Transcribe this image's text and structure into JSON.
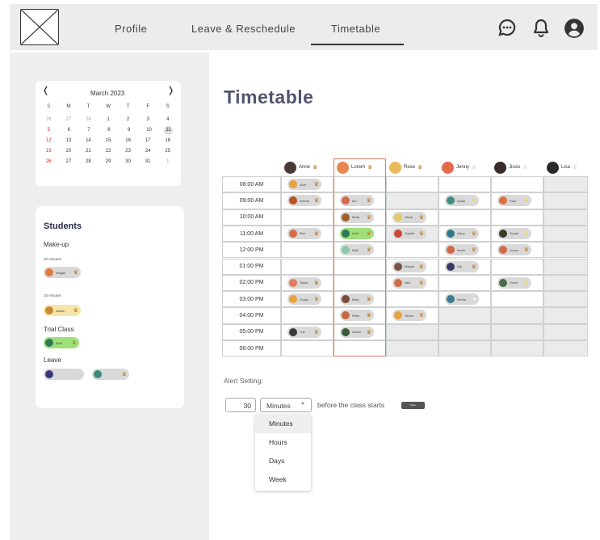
{
  "nav": {
    "profile": "Profile",
    "leave": "Leave & Reschedule",
    "timetable": "Timetable"
  },
  "calendar": {
    "title": "March 2023",
    "prev": "❬",
    "next": "❭",
    "weekdays": [
      "S",
      "M",
      "T",
      "W",
      "T",
      "F",
      "S"
    ],
    "weeks": [
      [
        "26",
        "27",
        "28",
        "1",
        "2",
        "3",
        "4"
      ],
      [
        "5",
        "6",
        "7",
        "8",
        "9",
        "10",
        "11"
      ],
      [
        "12",
        "13",
        "14",
        "15",
        "16",
        "17",
        "18"
      ],
      [
        "19",
        "20",
        "21",
        "22",
        "23",
        "24",
        "25"
      ],
      [
        "26",
        "27",
        "28",
        "29",
        "30",
        "31",
        "1"
      ]
    ],
    "selected": "11"
  },
  "students": {
    "title": "Students",
    "makeup": "Make-up",
    "m45": "45 minutes",
    "abigail": "Abigail",
    "m15": "15 minutes",
    "adrian": "Adrian",
    "trial": "Trial Class",
    "ariel": "Ariel",
    "leave": "Leave"
  },
  "page_title": "Timetable",
  "teachers": [
    {
      "name": "Anne",
      "c": "#4a3a35"
    },
    {
      "name": "Lorem",
      "c": "#e8864f"
    },
    {
      "name": "Rose",
      "c": "#e9b95c"
    },
    {
      "name": "Jenny",
      "c": "#e36b4e"
    },
    {
      "name": "Jisoo",
      "c": "#3a2a2a"
    },
    {
      "name": "Lisa",
      "c": "#2a2a2a"
    }
  ],
  "times": [
    "08:00 AM",
    "09:00 AM",
    "10:00 AM",
    "11:00 AM",
    "12:00 PM",
    "01:00 PM",
    "02:00 PM",
    "03:00 PM",
    "04:00 PM",
    "05:00 PM",
    "06:00 PM"
  ],
  "slots": [
    {
      "r": 0,
      "c": 0,
      "n": "Acre",
      "a": "#e8a23c"
    },
    {
      "r": 1,
      "c": 0,
      "n": "Wendy",
      "a": "#b7541e"
    },
    {
      "r": 1,
      "c": 1,
      "n": "Ian",
      "a": "#d46a4d"
    },
    {
      "r": 1,
      "c": 3,
      "n": "Dylan",
      "a": "#3f8f86",
      "k": "star"
    },
    {
      "r": 1,
      "c": 4,
      "n": "Paul",
      "a": "#e07040",
      "k": "star"
    },
    {
      "r": 2,
      "c": 1,
      "n": "Bella",
      "a": "#a15d2a"
    },
    {
      "r": 2,
      "c": 2,
      "n": "Olivia",
      "a": "#e3c96a"
    },
    {
      "r": 3,
      "c": 0,
      "n": "Ron",
      "a": "#d86a4a"
    },
    {
      "r": 3,
      "c": 1,
      "n": "Ariel",
      "a": "#2f7a5a",
      "g": "#9ee07a"
    },
    {
      "r": 3,
      "c": 2,
      "n": "Sophie",
      "a": "#c9483a"
    },
    {
      "r": 3,
      "c": 3,
      "n": "Harry",
      "a": "#2e7a8a"
    },
    {
      "r": 3,
      "c": 4,
      "n": "Susan",
      "a": "#3a3a28",
      "k": "star"
    },
    {
      "r": 4,
      "c": 1,
      "n": "Matt",
      "a": "#8ec6a6"
    },
    {
      "r": 4,
      "c": 3,
      "n": "Kevin",
      "a": "#d06a45"
    },
    {
      "r": 4,
      "c": 4,
      "n": "Lucas",
      "a": "#d46a4a"
    },
    {
      "r": 5,
      "c": 2,
      "n": "Megan",
      "a": "#7a5545"
    },
    {
      "r": 5,
      "c": 3,
      "n": "Lily",
      "a": "#3a3a6a"
    },
    {
      "r": 6,
      "c": 0,
      "n": "Taylor",
      "a": "#e07a60"
    },
    {
      "r": 6,
      "c": 2,
      "n": "Neil",
      "a": "#d46a4a"
    },
    {
      "r": 6,
      "c": 4,
      "n": "Victor",
      "a": "#4a6a4a",
      "k": "star"
    },
    {
      "r": 7,
      "c": 0,
      "n": "Grace",
      "a": "#e8a23c"
    },
    {
      "r": 7,
      "c": 1,
      "n": "Mary",
      "a": "#7a4a3a"
    },
    {
      "r": 7,
      "c": 3,
      "n": "Media",
      "a": "#3a7a8a",
      "k": "none"
    },
    {
      "r": 8,
      "c": 1,
      "n": "Peter",
      "a": "#c46a3a"
    },
    {
      "r": 8,
      "c": 2,
      "n": "Simon",
      "a": "#e8a23c"
    },
    {
      "r": 9,
      "c": 0,
      "n": "Yuli",
      "a": "#3a3a3a"
    },
    {
      "r": 9,
      "c": 1,
      "n": "Austin",
      "a": "#3a5a3a"
    }
  ],
  "alert": {
    "label": "Alert Setting:",
    "value": "30",
    "unit": "Minutes",
    "before": "before the class starts",
    "save": "Save",
    "options": [
      "Minutes",
      "Hours",
      "Days",
      "Week"
    ]
  }
}
